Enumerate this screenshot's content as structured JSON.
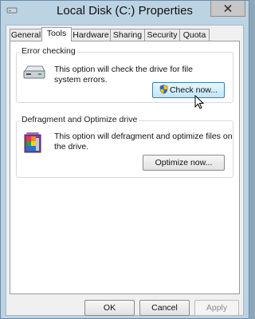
{
  "window": {
    "title": "Local Disk (C:) Properties"
  },
  "tabs": [
    {
      "label": "General"
    },
    {
      "label": "Tools"
    },
    {
      "label": "Hardware"
    },
    {
      "label": "Sharing"
    },
    {
      "label": "Security"
    },
    {
      "label": "Quota"
    }
  ],
  "active_tab": "Tools",
  "error_checking": {
    "label": "Error checking",
    "description_line1": "This option will check the drive for file",
    "description_line2": "system errors.",
    "button": "Check now..."
  },
  "defrag": {
    "label": "Defragment and Optimize drive",
    "description_line1": "This option will defragment and optimize files on",
    "description_line2": "the drive.",
    "button": "Optimize now..."
  },
  "footer": {
    "ok": "OK",
    "cancel": "Cancel",
    "apply": "Apply"
  },
  "colors": {
    "window_frame": "#bcd3e4",
    "focus_button": "#bee6fd"
  }
}
